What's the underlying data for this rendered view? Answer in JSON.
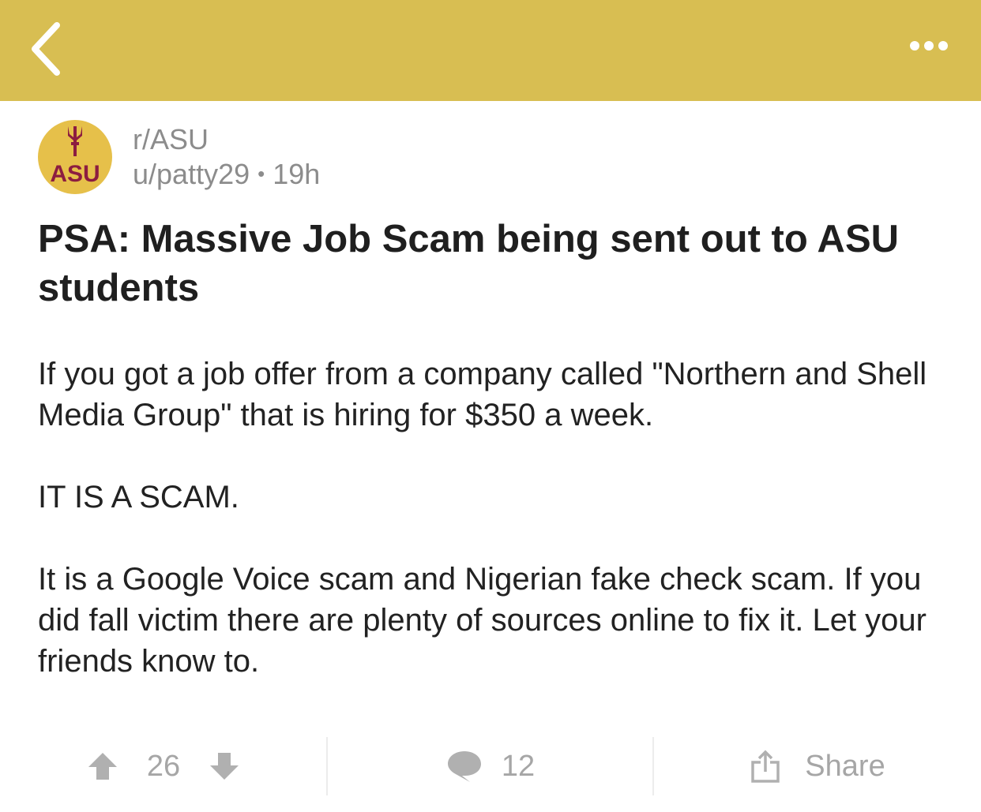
{
  "header": {
    "back_icon": "chevron-left-icon",
    "more_icon": "more-horizontal-icon",
    "bar_color": "#d8be52"
  },
  "post": {
    "subreddit": "r/ASU",
    "author": "u/patty29",
    "separator": "•",
    "age": "19h",
    "avatar_text": "ASU",
    "title": "PSA: Massive Job Scam being sent out to ASU students",
    "body": [
      "If you got a job offer from a company called \"Northern and Shell Media Group\" that is hiring for $350 a week.",
      "IT IS A SCAM.",
      "It is a Google Voice scam and Nigerian fake check scam. If you did fall victim there are plenty of sources online to fix it. Let your friends know to."
    ]
  },
  "actions": {
    "upvote_icon": "arrow-up-icon",
    "downvote_icon": "arrow-down-icon",
    "score": "26",
    "comment_icon": "comment-bubble-icon",
    "comment_count": "12",
    "share_icon": "share-icon",
    "share_label": "Share"
  }
}
